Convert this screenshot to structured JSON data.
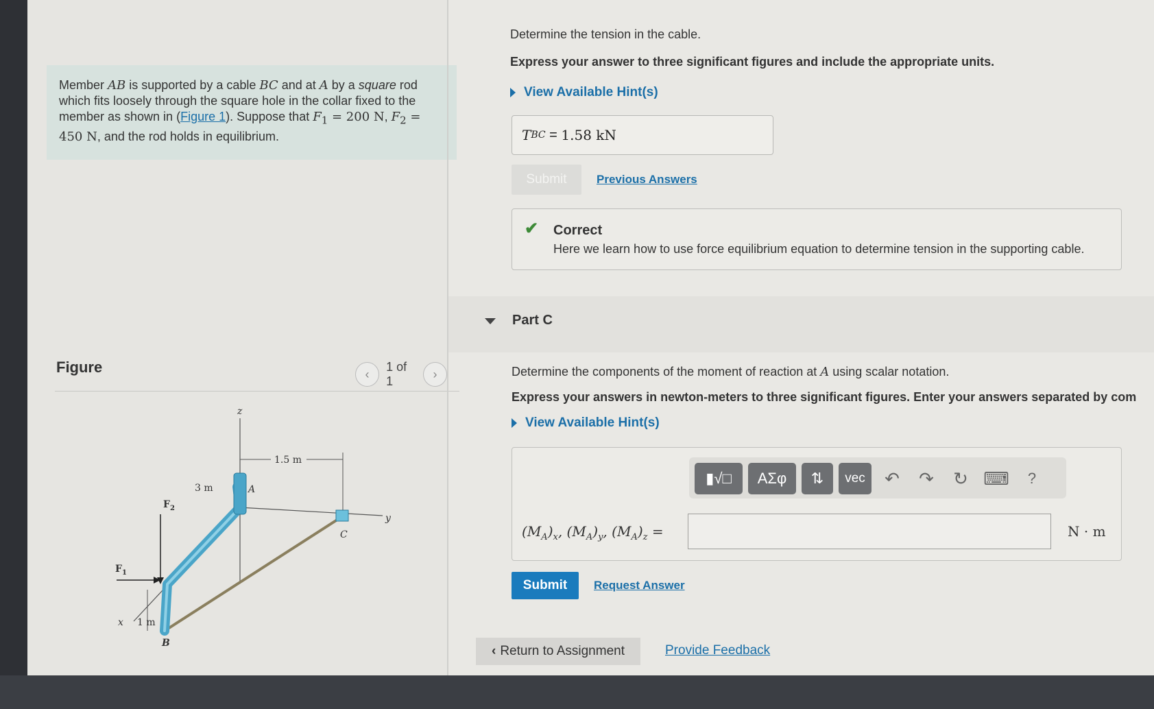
{
  "problem": {
    "p1": "Member ",
    "ab": "AB",
    "p2": " is supported by a cable ",
    "bc": "BC",
    "p3": " and at ",
    "a": "A",
    "p4": " by a ",
    "square": "square",
    "p5": " rod which fits loosely through the square hole in the collar fixed to the member as shown in (",
    "figure_link": "Figure 1",
    "p6": "). Suppose that ",
    "f1": "F",
    "f1_sub": "1",
    "f1_val": " = 200 N",
    "p7": ",",
    "f2": "F",
    "f2_sub": "2",
    "f2_val": " = 450 N",
    "p8": ", and the rod holds in equilibrium."
  },
  "figure_panel": {
    "label": "Figure",
    "pager_text": "1 of 1",
    "prev_icon": "chevron-left-icon",
    "next_icon": "chevron-right-icon",
    "diagram": {
      "z": "z",
      "y": "y",
      "x": "x",
      "dim_15": "1.5 m",
      "dim_3": "3 m",
      "dim_1": "1 m",
      "pt_a": "A",
      "pt_b": "B",
      "pt_c": "C",
      "f1": "F",
      "f1_sub": "1",
      "f2": "F",
      "f2_sub": "2"
    }
  },
  "part_b": {
    "question": "Determine the tension in the cable.",
    "instruction": "Express your answer to three significant figures and include the appropriate units.",
    "hint_label": "View Available Hint(s)",
    "answer_var": "T",
    "answer_sub": "BC",
    "answer_eq": " = ",
    "answer_value": "1.58 kN",
    "submit_label": "Submit",
    "previous_answers_label": "Previous Answers",
    "correct_title": "Correct",
    "correct_message": "Here we learn how to use force equilibrium equation to determine tension in the supporting cable."
  },
  "part_c": {
    "label": "Part C",
    "q1": "Determine the components of the moment of reaction at ",
    "q_a": "A",
    "q2": " using scalar notation.",
    "instruction": "Express your answers in newton-meters to three significant figures. Enter your answers separated by com",
    "hint_label": "View Available Hint(s)",
    "toolbar": {
      "templates": "▮√□",
      "greek": "ΑΣφ",
      "updown": "⇅",
      "vec": "vec",
      "undo": "↶",
      "redo": "↷",
      "reset": "↻",
      "keyboard": "⌨",
      "help": "?"
    },
    "eq_label": "(Mₐ)ₓ, (Mₐ)ᵧ, (Mₐ)ₓ =",
    "eq_value": "",
    "eq_unit": "N · m",
    "submit_label": "Submit",
    "request_answer_label": "Request Answer"
  },
  "footer": {
    "return_label": "Return to Assignment",
    "feedback_label": "Provide Feedback"
  }
}
